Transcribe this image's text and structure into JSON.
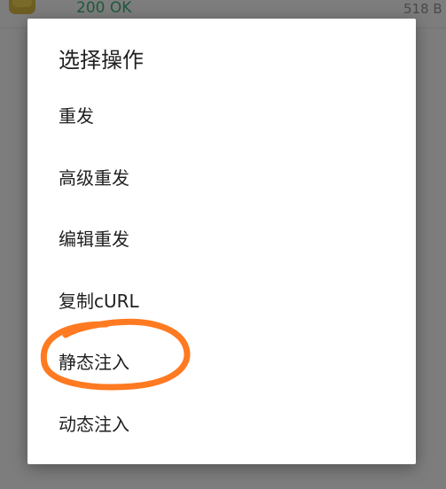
{
  "background_row": {
    "status": "200 OK",
    "size": "518 B"
  },
  "dialog": {
    "title": "选择操作",
    "items": [
      {
        "label": "重发"
      },
      {
        "label": "高级重发"
      },
      {
        "label": "编辑重发"
      },
      {
        "label": "复制cURL"
      },
      {
        "label": "静态注入"
      },
      {
        "label": "动态注入"
      }
    ]
  },
  "colors": {
    "scrim": "#7d7d7d",
    "dialog_bg": "#ffffff",
    "text": "#1f1f1f",
    "status_green": "#1d5a3c",
    "annotation_orange": "#ff7a21"
  }
}
